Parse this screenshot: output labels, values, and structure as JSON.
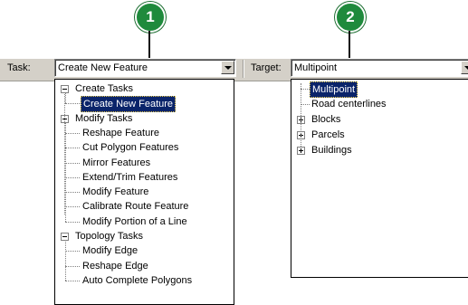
{
  "callouts": [
    "1",
    "2"
  ],
  "task": {
    "label": "Task:",
    "value": "Create New Feature",
    "tree": [
      {
        "label": "Create Tasks",
        "children": [
          "Create New Feature"
        ]
      },
      {
        "label": "Modify Tasks",
        "children": [
          "Reshape Feature",
          "Cut Polygon Features",
          "Mirror Features",
          "Extend/Trim Features",
          "Modify Feature",
          "Calibrate Route Feature",
          "Modify Portion of a Line"
        ]
      },
      {
        "label": "Topology Tasks",
        "children": [
          "Modify Edge",
          "Reshape Edge",
          "Auto Complete Polygons"
        ]
      }
    ],
    "selected": "Create New Feature"
  },
  "target": {
    "label": "Target:",
    "value": "Multipoint",
    "items": [
      {
        "label": "Multipoint",
        "expandable": false
      },
      {
        "label": "Road centerlines",
        "expandable": false
      },
      {
        "label": "Blocks",
        "expandable": true
      },
      {
        "label": "Parcels",
        "expandable": true
      },
      {
        "label": "Buildings",
        "expandable": true
      }
    ],
    "selected": "Multipoint"
  },
  "colors": {
    "callout": "#1f8a3c",
    "selection": "#0a246a",
    "toolbar": "#d4d0c8"
  },
  "icons": {
    "dropdown": "chevron-down-icon",
    "expand": "plus-box-icon",
    "collapse": "minus-box-icon"
  }
}
